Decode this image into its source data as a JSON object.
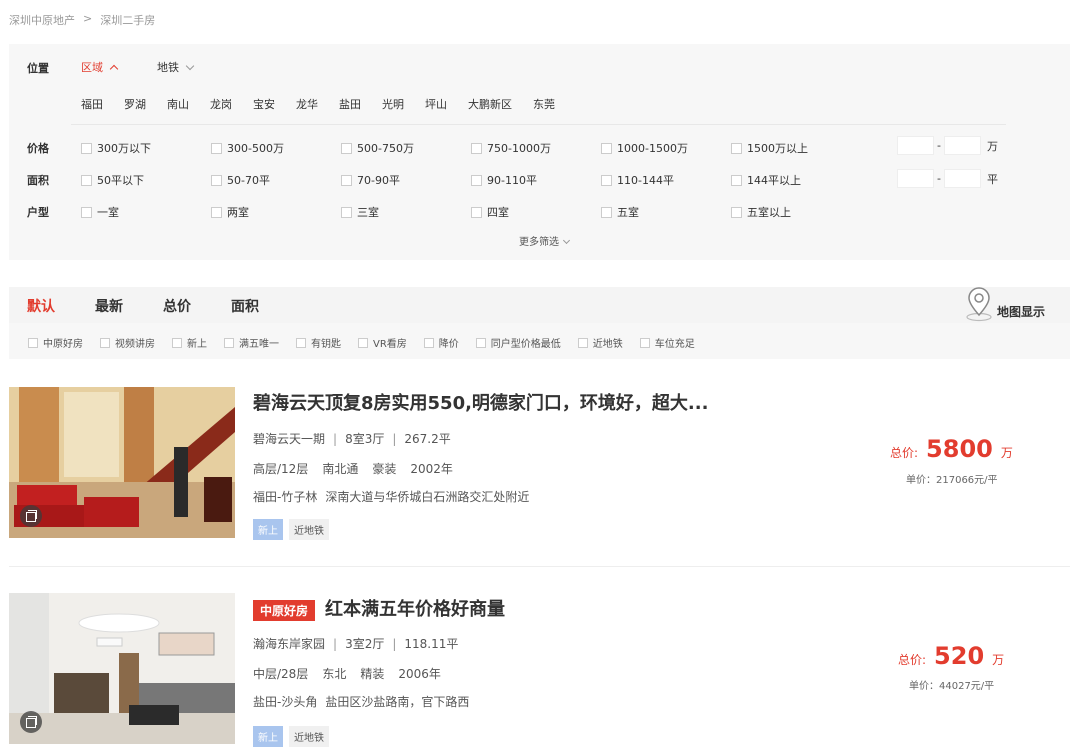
{
  "breadcrumb": {
    "home": "深圳中原地产",
    "sep": ">",
    "current": "深圳二手房"
  },
  "filters": {
    "location_label": "位置",
    "tabs": [
      "区域",
      "地铁"
    ],
    "districts": [
      "福田",
      "罗湖",
      "南山",
      "龙岗",
      "宝安",
      "龙华",
      "盐田",
      "光明",
      "坪山",
      "大鹏新区",
      "东莞"
    ],
    "price": {
      "label": "价格",
      "options": [
        "300万以下",
        "300-500万",
        "500-750万",
        "750-1000万",
        "1000-1500万",
        "1500万以上"
      ],
      "dash": "-",
      "unit": "万"
    },
    "area": {
      "label": "面积",
      "options": [
        "50平以下",
        "50-70平",
        "70-90平",
        "90-110平",
        "110-144平",
        "144平以上"
      ],
      "dash": "-",
      "unit": "平"
    },
    "layout": {
      "label": "户型",
      "options": [
        "一室",
        "两室",
        "三室",
        "四室",
        "五室",
        "五室以上"
      ]
    },
    "more": "更多筛选"
  },
  "sort": {
    "options": [
      "默认",
      "最新",
      "总价",
      "面积"
    ],
    "active": "默认",
    "map": "地图显示"
  },
  "quick_tags": [
    "中原好房",
    "视频讲房",
    "新上",
    "满五唯一",
    "有钥匙",
    "VR看房",
    "降价",
    "同户型价格最低",
    "近地铁",
    "车位充足"
  ],
  "listings": [
    {
      "title": "碧海云天顶复8房实用550,明德家门口，环境好，超大...",
      "community": "碧海云天一期",
      "rooms": "8室3厅",
      "area": "267.2平",
      "floor": "高层/12层",
      "orient": "南北通",
      "deco": "豪装",
      "year": "2002年",
      "region": "福田-竹子林",
      "address": "深南大道与华侨城白石洲路交汇处附近",
      "tags": [
        "新上",
        "近地铁"
      ],
      "price_label": "总价:",
      "price": "5800",
      "price_unit": "万",
      "unit_price": "单价：217066元/平"
    },
    {
      "badge": "中原好房",
      "title": "红本满五年价格好商量",
      "community": "瀚海东岸家园",
      "rooms": "3室2厅",
      "area": "118.11平",
      "floor": "中层/28层",
      "orient": "东北",
      "deco": "精装",
      "year": "2006年",
      "region": "盐田-沙头角",
      "address": "盐田区沙盐路南，官下路西",
      "tags": [
        "新上",
        "近地铁"
      ],
      "price_label": "总价:",
      "price": "520",
      "price_unit": "万",
      "unit_price": "单价：44027元/平"
    }
  ],
  "colors": {
    "accent": "#e23c2e",
    "tag_new": "#a9c5ee"
  }
}
